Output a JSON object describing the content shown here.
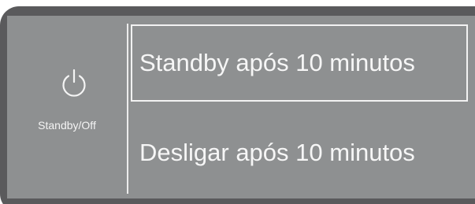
{
  "standby_button": {
    "icon": "power-icon",
    "label": "Standby/Off"
  },
  "options": [
    {
      "label": "Standby após 10 minutos",
      "selected": true
    },
    {
      "label": "Desligar após 10 minutos",
      "selected": false
    }
  ],
  "colors": {
    "bezel": "#5a5a5c",
    "screen": "#8e9091",
    "text": "#f6f6f6",
    "highlight_border": "#f2f2f2"
  }
}
